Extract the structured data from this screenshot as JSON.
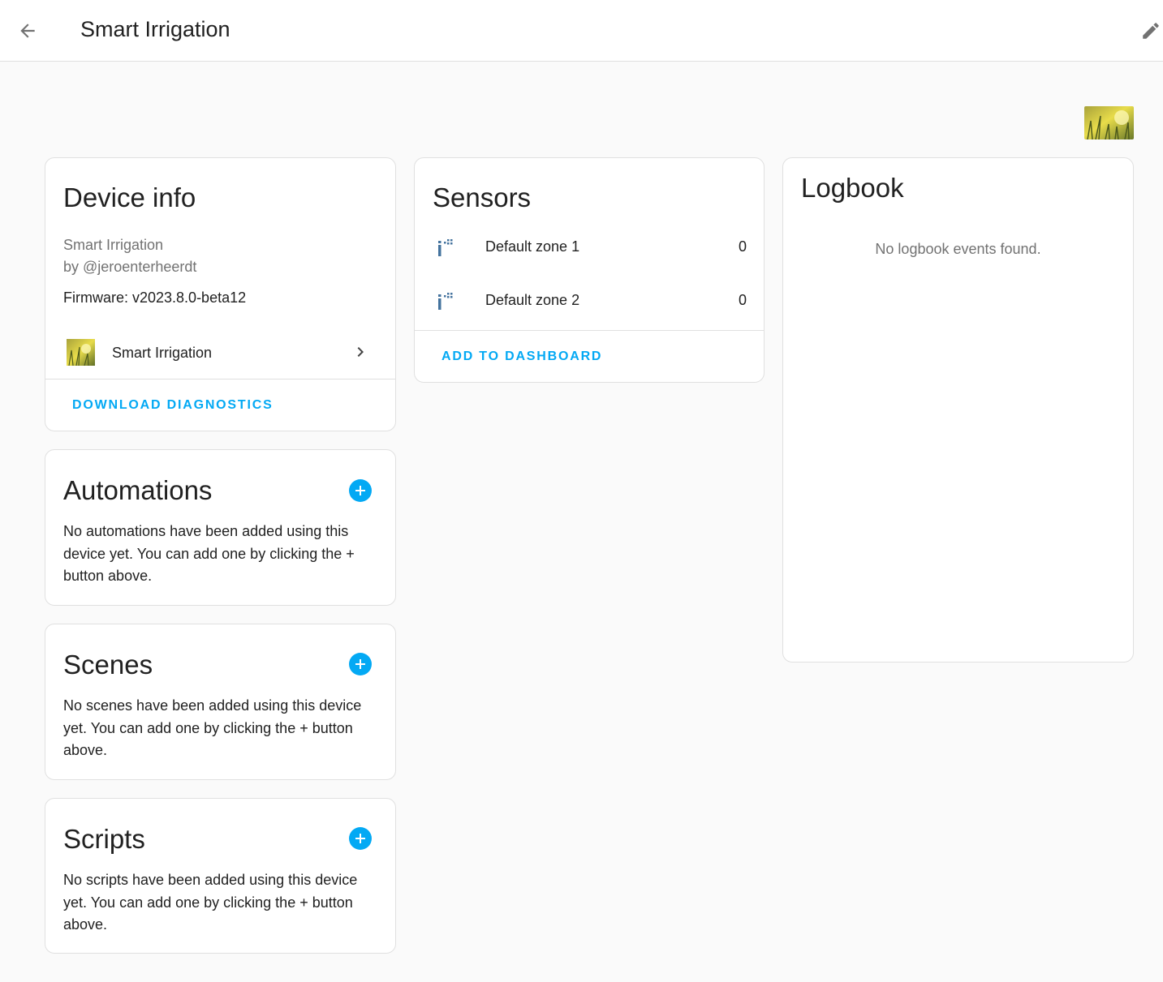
{
  "header": {
    "title": "Smart Irrigation",
    "back_icon": "arrow-left-icon",
    "edit_icon": "pencil-icon"
  },
  "device_info": {
    "title": "Device info",
    "model": "Smart Irrigation",
    "manufacturer": "by @jeroenterheerdt",
    "firmware": "Firmware: v2023.8.0-beta12",
    "integration_label": "Smart Irrigation",
    "download_label": "DOWNLOAD DIAGNOSTICS"
  },
  "sensors": {
    "title": "Sensors",
    "items": [
      {
        "name": "Default zone 1",
        "value": "0",
        "icon": "sprinkler-icon"
      },
      {
        "name": "Default zone 2",
        "value": "0",
        "icon": "sprinkler-icon"
      }
    ],
    "add_label": "ADD TO DASHBOARD"
  },
  "logbook": {
    "title": "Logbook",
    "empty": "No logbook events found."
  },
  "automations": {
    "title": "Automations",
    "text": "No automations have been added using this device yet. You can add one by clicking the + button above."
  },
  "scenes": {
    "title": "Scenes",
    "text": "No scenes have been added using this device yet. You can add one by clicking the + button above."
  },
  "scripts": {
    "title": "Scripts",
    "text": "No scripts have been added using this device yet. You can add one by clicking the + button above."
  },
  "colors": {
    "accent": "#03a9f4",
    "sensor_icon": "#44739e",
    "text": "#212121",
    "muted": "#727272"
  }
}
